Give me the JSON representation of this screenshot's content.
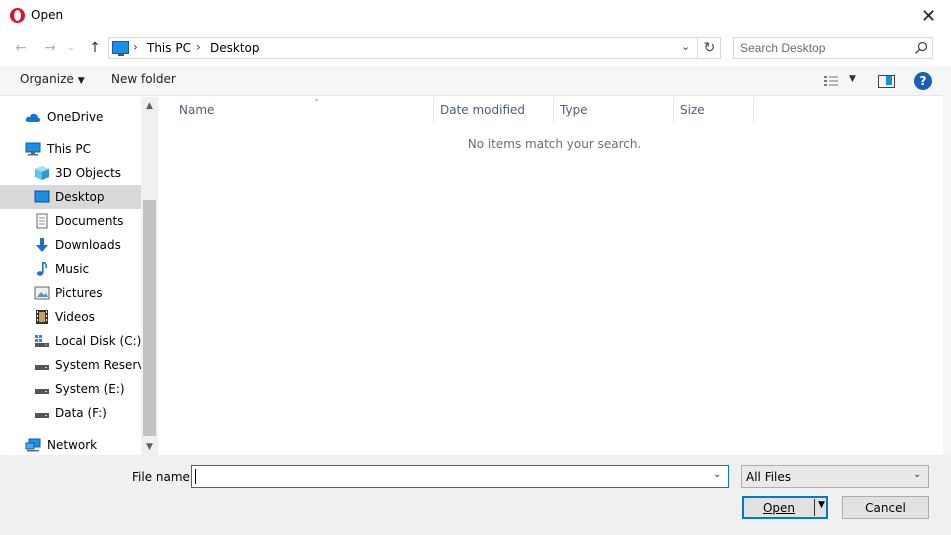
{
  "window": {
    "title": "Open",
    "close_label": "✕"
  },
  "address": {
    "crumbs": [
      "This PC",
      "Desktop"
    ],
    "separator": "›"
  },
  "search": {
    "placeholder": "Search Desktop"
  },
  "toolbar": {
    "organize_label": "Organize",
    "new_folder_label": "New folder",
    "help_label": "?"
  },
  "nav": {
    "items": [
      {
        "label": "OneDrive",
        "icon": "cloud-icon"
      },
      {
        "label": "This PC",
        "icon": "computer-icon"
      },
      {
        "label": "3D Objects",
        "icon": "cube-icon"
      },
      {
        "label": "Desktop",
        "icon": "desktop-icon",
        "selected": true
      },
      {
        "label": "Documents",
        "icon": "document-icon"
      },
      {
        "label": "Downloads",
        "icon": "download-arrow-icon"
      },
      {
        "label": "Music",
        "icon": "music-note-icon"
      },
      {
        "label": "Pictures",
        "icon": "picture-icon"
      },
      {
        "label": "Videos",
        "icon": "film-icon"
      },
      {
        "label": "Local Disk (C:)",
        "icon": "windows-drive-icon"
      },
      {
        "label": "System Reserved",
        "icon": "drive-icon"
      },
      {
        "label": "System (E:)",
        "icon": "drive-icon"
      },
      {
        "label": "Data (F:)",
        "icon": "drive-icon"
      },
      {
        "label": "Network",
        "icon": "network-icon"
      }
    ]
  },
  "file_list": {
    "columns": [
      "Name",
      "Date modified",
      "Type",
      "Size"
    ],
    "empty_message": "No items match your search."
  },
  "footer": {
    "file_name_label": "File name:",
    "file_name_value": "",
    "filter_value": "All Files",
    "open_label": "Open",
    "cancel_label": "Cancel"
  },
  "colors": {
    "accent": "#0078d7",
    "selection": "#d9d9d9",
    "brand": "#e0102a"
  }
}
